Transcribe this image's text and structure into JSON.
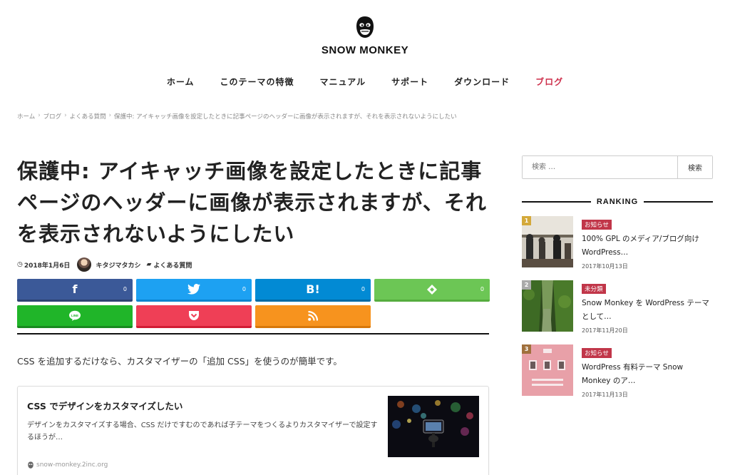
{
  "header": {
    "site_name": "SNOW MONKEY",
    "logo_icon": "monkey-face-icon"
  },
  "nav": {
    "items": [
      {
        "label": "ホーム"
      },
      {
        "label": "このテーマの特徴"
      },
      {
        "label": "マニュアル"
      },
      {
        "label": "サポート"
      },
      {
        "label": "ダウンロード"
      },
      {
        "label": "ブログ",
        "current": true
      }
    ],
    "active_color": "#cd2e4a"
  },
  "breadcrumb": {
    "items": [
      "ホーム",
      "ブログ",
      "よくある質問",
      "保護中: アイキャッチ画像を設定したときに記事ページのヘッダーに画像が表示されますが、それを表示されないようにしたい"
    ],
    "separator": "›"
  },
  "article": {
    "title": "保護中: アイキャッチ画像を設定したときに記事ページのヘッダーに画像が表示されますが、それを表示されないようにしたい",
    "date": "2018年1月6日",
    "author": "キタジマタカシ",
    "category": "よくある質問",
    "lead": "CSS を追加するだけなら、カスタマイザーの「追加 CSS」を使うのが簡単です。"
  },
  "share": {
    "buttons": [
      {
        "name": "facebook",
        "icon": "f",
        "count": "0"
      },
      {
        "name": "twitter",
        "icon": "twitter-bird",
        "count": "0"
      },
      {
        "name": "hatena",
        "icon": "B!",
        "count": "0"
      },
      {
        "name": "feedly",
        "icon": "feedly",
        "count": "0"
      },
      {
        "name": "line",
        "icon": "LINE"
      },
      {
        "name": "pocket",
        "icon": "pocket"
      },
      {
        "name": "rss",
        "icon": "rss"
      }
    ]
  },
  "card": {
    "title": "CSS でデザインをカスタマイズしたい",
    "description": "デザインをカスタマイズする場合、CSS だけですむのであれば子テーマをつくるよりカスタマイザーで設定するほうが…",
    "site": "snow-monkey.2inc.org"
  },
  "sidebar": {
    "search_placeholder": "検索 …",
    "search_button": "検索",
    "ranking_label": "RANKING",
    "ranking": [
      {
        "rank": "1",
        "badge": "お知らせ",
        "title": "100% GPL のメディア/ブログ向け WordPress…",
        "date": "2017年10月13日",
        "rank_color": "#d4a93a"
      },
      {
        "rank": "2",
        "badge": "未分類",
        "title": "Snow Monkey を WordPress テーマとして…",
        "date": "2017年11月20日",
        "rank_color": "#aaaaaa"
      },
      {
        "rank": "3",
        "badge": "お知らせ",
        "title": "WordPress 有料テーマ Snow Monkey のア…",
        "date": "2017年11月13日",
        "rank_color": "#a0703c"
      }
    ]
  }
}
